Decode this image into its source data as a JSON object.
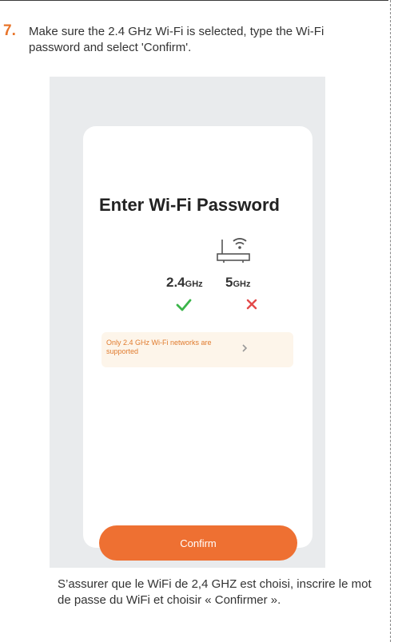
{
  "step": {
    "number": "7.",
    "instruction": "Make sure the 2.4 GHz Wi-Fi is selected, type the Wi-Fi password and select 'Confirm'."
  },
  "screen": {
    "title": "Enter Wi-Fi Password",
    "bands": [
      {
        "number": "2.4",
        "unit": "GHz",
        "supported": true
      },
      {
        "number": "5",
        "unit": "GHz",
        "supported": false
      }
    ],
    "notice": "Only 2.4 GHz Wi-Fi networks are supported",
    "confirm_label": "Confirm"
  },
  "french_instruction": "S’assurer que le WiFi de 2,4 GHZ est choisi, inscrire le mot de passe du WiFi et choisir « Confirmer ».",
  "colors": {
    "accent_orange": "#ee7032",
    "success_green": "#3bb54a",
    "error_red": "#e34a4a",
    "notice_bg": "#fdf5ea"
  },
  "icons": {
    "router": "router-icon",
    "check": "checkmark-icon",
    "cross": "cross-icon",
    "arrow": "chevron-right-icon"
  }
}
